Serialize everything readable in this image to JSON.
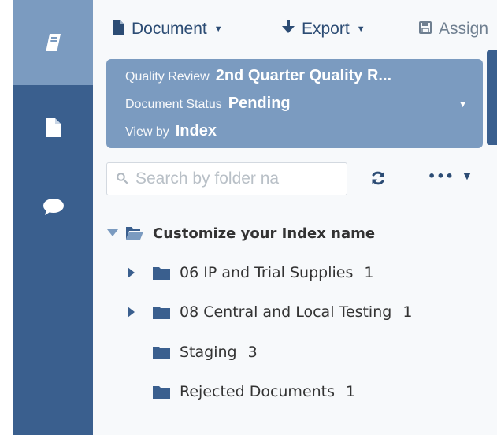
{
  "colors": {
    "rail": "#3a5f8e",
    "rail_active": "#7b9bc0",
    "accent": "#2c4c74",
    "card": "#7b9bc0",
    "folder": "#3a5f8e"
  },
  "rail": {
    "items": [
      {
        "icon": "book-icon",
        "active": true
      },
      {
        "icon": "document-icon",
        "active": false
      },
      {
        "icon": "chat-bubble-icon",
        "active": false
      }
    ]
  },
  "toolbar": {
    "document_label": "Document",
    "export_label": "Export",
    "assign_label": "Assign"
  },
  "info": {
    "quality_review_label": "Quality Review",
    "quality_review_value": "2nd Quarter Quality R...",
    "document_status_label": "Document Status",
    "document_status_value": "Pending",
    "view_by_label": "View by",
    "view_by_value": "Index"
  },
  "search": {
    "placeholder": "Search by folder na",
    "value": ""
  },
  "tree": {
    "root_label": "Customize your Index name",
    "items": [
      {
        "label": "06 IP and Trial Supplies",
        "count": "1",
        "expandable": true
      },
      {
        "label": "08 Central and Local Testing",
        "count": "1",
        "expandable": true
      },
      {
        "label": "Staging",
        "count": "3",
        "expandable": false
      },
      {
        "label": "Rejected Documents",
        "count": "1",
        "expandable": false
      }
    ]
  }
}
